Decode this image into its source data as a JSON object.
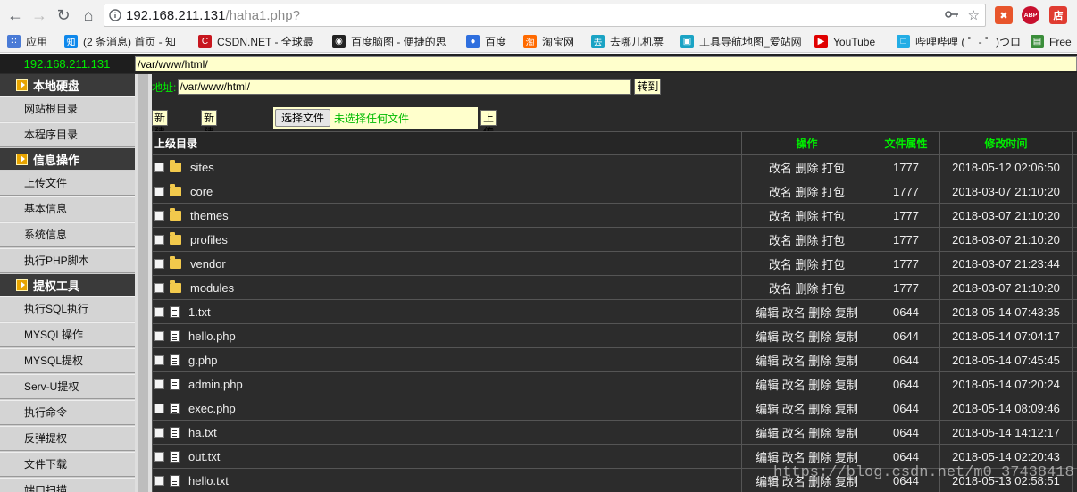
{
  "browser": {
    "url_host": "192.168.211.131",
    "url_path": "/haha1.php?",
    "bookmarks": [
      {
        "label": "应用",
        "icon": "apps-grid-icon",
        "color": "#4a7bd6"
      },
      {
        "label": "(2 条消息) 首页 - 知",
        "icon": "zhihu-icon",
        "color": "#0f88eb"
      },
      {
        "label": "CSDN.NET - 全球最",
        "icon": "csdn-icon",
        "color": "#c7161e"
      },
      {
        "label": "百度脑图 - 便捷的思",
        "icon": "baidu-naotu-icon",
        "color": "#222222"
      },
      {
        "label": "百度",
        "icon": "baidu-paw-icon",
        "color": "#2f6fde"
      },
      {
        "label": "淘宝网",
        "icon": "taobao-icon",
        "color": "#ff6a00"
      },
      {
        "label": "去哪儿机票",
        "icon": "qunar-icon",
        "color": "#1aa3c4"
      },
      {
        "label": "工具导航地图_爱站网",
        "icon": "aizhan-icon",
        "color": "#1aa3c4"
      },
      {
        "label": "YouTube",
        "icon": "youtube-icon",
        "color": "#e00000"
      },
      {
        "label": "哔哩哔哩 ( ゜- ゜)つロ",
        "icon": "bilibili-icon",
        "color": "#23ade5"
      },
      {
        "label": "Free",
        "icon": "free-icon",
        "color": "#3a8d3a"
      }
    ]
  },
  "page": {
    "host": "192.168.211.131",
    "current_path": "/var/www/html/",
    "address_label": "地址:",
    "address_value": "/var/www/html/",
    "go_button": "转到",
    "new_file_button": "新建文件",
    "new_dir_button": "新建目录",
    "choose_file_button": "选择文件",
    "no_file_text": "未选择任何文件",
    "upload_button": "上传"
  },
  "sidebar": [
    {
      "type": "head",
      "label": "本地硬盘"
    },
    {
      "type": "item",
      "label": "网站根目录"
    },
    {
      "type": "item",
      "label": "本程序目录"
    },
    {
      "type": "head",
      "label": "信息操作"
    },
    {
      "type": "item",
      "label": "上传文件"
    },
    {
      "type": "item",
      "label": "基本信息"
    },
    {
      "type": "item",
      "label": "系统信息"
    },
    {
      "type": "item",
      "label": "执行PHP脚本"
    },
    {
      "type": "head",
      "label": "提权工具"
    },
    {
      "type": "item",
      "label": "执行SQL执行"
    },
    {
      "type": "item",
      "label": "MYSQL操作"
    },
    {
      "type": "item",
      "label": "MYSQL提权"
    },
    {
      "type": "item",
      "label": "Serv-U提权"
    },
    {
      "type": "item",
      "label": "执行命令"
    },
    {
      "type": "item",
      "label": "反弹提权"
    },
    {
      "type": "item",
      "label": "文件下载"
    },
    {
      "type": "item",
      "label": "端口扫描"
    }
  ],
  "table": {
    "headers": [
      "上级目录",
      "操作",
      "文件属性",
      "修改时间"
    ],
    "rows": [
      {
        "kind": "folder",
        "name": "sites",
        "ops": "改名 删除 打包",
        "perm": "1777",
        "time": "2018-05-12 02:06:50"
      },
      {
        "kind": "folder",
        "name": "core",
        "ops": "改名 删除 打包",
        "perm": "1777",
        "time": "2018-03-07 21:10:20"
      },
      {
        "kind": "folder",
        "name": "themes",
        "ops": "改名 删除 打包",
        "perm": "1777",
        "time": "2018-03-07 21:10:20"
      },
      {
        "kind": "folder",
        "name": "profiles",
        "ops": "改名 删除 打包",
        "perm": "1777",
        "time": "2018-03-07 21:10:20"
      },
      {
        "kind": "folder",
        "name": "vendor",
        "ops": "改名 删除 打包",
        "perm": "1777",
        "time": "2018-03-07 21:23:44"
      },
      {
        "kind": "folder",
        "name": "modules",
        "ops": "改名 删除 打包",
        "perm": "1777",
        "time": "2018-03-07 21:10:20"
      },
      {
        "kind": "file",
        "name": "1.txt",
        "ops": "编辑 改名 删除 复制",
        "perm": "0644",
        "time": "2018-05-14 07:43:35"
      },
      {
        "kind": "file",
        "name": "hello.php",
        "ops": "编辑 改名 删除 复制",
        "perm": "0644",
        "time": "2018-05-14 07:04:17"
      },
      {
        "kind": "file",
        "name": "g.php",
        "ops": "编辑 改名 删除 复制",
        "perm": "0644",
        "time": "2018-05-14 07:45:45"
      },
      {
        "kind": "file",
        "name": "admin.php",
        "ops": "编辑 改名 删除 复制",
        "perm": "0644",
        "time": "2018-05-14 07:20:24"
      },
      {
        "kind": "file",
        "name": "exec.php",
        "ops": "编辑 改名 删除 复制",
        "perm": "0644",
        "time": "2018-05-14 08:09:46"
      },
      {
        "kind": "file",
        "name": "ha.txt",
        "ops": "编辑 改名 删除 复制",
        "perm": "0644",
        "time": "2018-05-14 14:12:17"
      },
      {
        "kind": "file",
        "name": "out.txt",
        "ops": "编辑 改名 删除 复制",
        "perm": "0644",
        "time": "2018-05-14 02:20:43"
      },
      {
        "kind": "file",
        "name": "hello.txt",
        "ops": "编辑 改名 删除 复制",
        "perm": "0644",
        "time": "2018-05-13 02:58:51"
      }
    ]
  },
  "watermark": "https://blog.csdn.net/m0_37438418",
  "colors": {
    "accent_green": "#00ee00",
    "input_bg": "#ffffcc",
    "panel_bg": "#2b2b2b"
  }
}
